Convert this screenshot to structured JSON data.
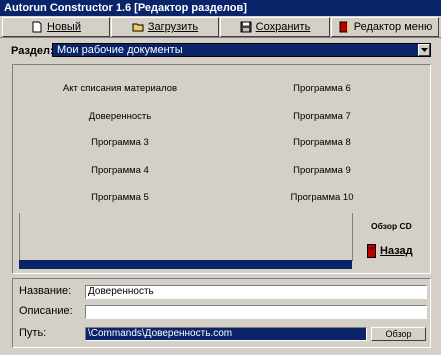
{
  "window": {
    "title": "Autorun Constructor 1.6 [Редактор разделов]"
  },
  "toolbar": {
    "new_label": "Новый",
    "load_label": "Загрузить",
    "save_label": "Сохранить",
    "menu_editor_label": "Редактор меню"
  },
  "section": {
    "label": "Раздел:",
    "selected": "Мои рабочие документы"
  },
  "items_left": [
    "Акт списания материалов",
    "Доверенность",
    "Программа 3",
    "Программа 4",
    "Программа 5"
  ],
  "items_right": [
    "Программа 6",
    "Программа 7",
    "Программа 8",
    "Программа 9",
    "Программа 10"
  ],
  "side": {
    "browse_cd_label": "Обзор CD",
    "back_label": "Назад"
  },
  "fields": {
    "name_label": "Название:",
    "name_value": "Доверенность",
    "description_label": "Описание:",
    "description_value": "",
    "path_label": "Путь:",
    "path_value": "\\Commands\\Доверенность.com",
    "browse_label": "Обзор"
  },
  "colors": {
    "face": "#d4d0c8",
    "selection": "#0a246a"
  }
}
